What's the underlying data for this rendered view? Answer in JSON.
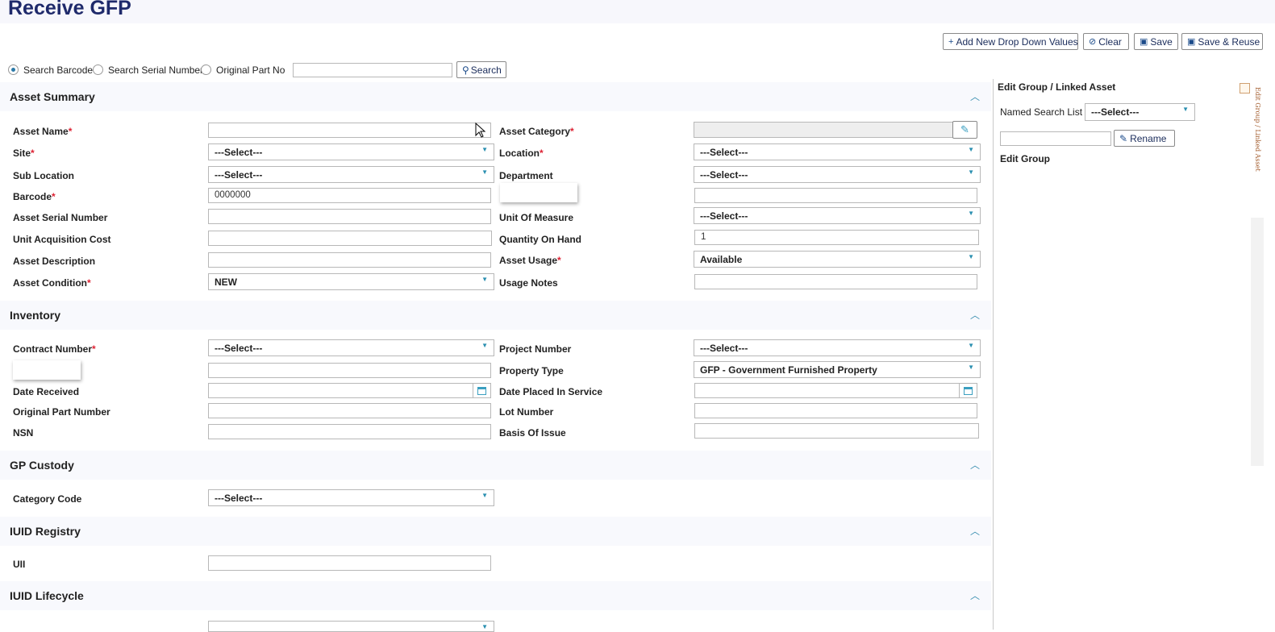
{
  "page": {
    "title": "Receive GFP"
  },
  "toolbar": {
    "add_label": "Add New Drop Down Values",
    "clear_label": "Clear",
    "save_label": "Save",
    "save_reuse_label": "Save & Reuse"
  },
  "search": {
    "options": [
      "Search Barcode",
      "Search Serial Number",
      "Original Part No"
    ],
    "selected": "Search Barcode",
    "input_value": "",
    "button_label": "Search"
  },
  "sections": {
    "asset_summary": "Asset Summary",
    "inventory": "Inventory",
    "gp_custody": "GP Custody",
    "iuid_registry": "IUID Registry",
    "iuid_lifecycle": "IUID Lifecycle"
  },
  "asset_summary": {
    "asset_name": {
      "label": "Asset Name",
      "value": ""
    },
    "asset_category": {
      "label": "Asset Category",
      "value": ""
    },
    "site": {
      "label": "Site",
      "value": "---Select---"
    },
    "location": {
      "label": "Location",
      "value": "---Select---"
    },
    "sub_location": {
      "label": "Sub Location",
      "value": "---Select---"
    },
    "department": {
      "label": "Department",
      "value": "---Select---"
    },
    "barcode": {
      "label": "Barcode",
      "value": "0000000"
    },
    "unlabeled_right": {
      "value": ""
    },
    "asset_serial_number": {
      "label": "Asset Serial Number",
      "value": ""
    },
    "unit_of_measure": {
      "label": "Unit Of Measure",
      "value": "---Select---"
    },
    "unit_acquisition_cost": {
      "label": "Unit Acquisition Cost",
      "value": ""
    },
    "quantity_on_hand": {
      "label": "Quantity On Hand",
      "value": "1"
    },
    "asset_description": {
      "label": "Asset Description",
      "value": ""
    },
    "asset_usage": {
      "label": "Asset Usage",
      "value": "Available"
    },
    "asset_condition": {
      "label": "Asset Condition",
      "value": "NEW"
    },
    "usage_notes": {
      "label": "Usage Notes",
      "value": ""
    }
  },
  "inventory": {
    "contract_number": {
      "label": "Contract Number",
      "value": "---Select---"
    },
    "project_number": {
      "label": "Project Number",
      "value": "---Select---"
    },
    "unlabeled_left": {
      "value": ""
    },
    "property_type": {
      "label": "Property Type",
      "value": "GFP - Government Furnished Property"
    },
    "date_received": {
      "label": "Date Received",
      "value": ""
    },
    "date_placed_in_service": {
      "label": "Date Placed In Service",
      "value": ""
    },
    "original_part_number": {
      "label": "Original Part Number",
      "value": ""
    },
    "lot_number": {
      "label": "Lot Number",
      "value": ""
    },
    "nsn": {
      "label": "NSN",
      "value": ""
    },
    "basis_of_issue": {
      "label": "Basis Of Issue",
      "value": ""
    }
  },
  "gp_custody": {
    "category_code": {
      "label": "Category Code",
      "value": "---Select---"
    }
  },
  "iuid_registry": {
    "uii": {
      "label": "UII",
      "value": ""
    }
  },
  "right_panel": {
    "title": "Edit Group / Linked Asset",
    "named_search_label": "Named Search List :",
    "named_search_value": "---Select---",
    "rename_input": "",
    "rename_label": "Rename",
    "edit_group_label": "Edit Group",
    "vertical_tab": "Edit Group / Linked Asset"
  },
  "colors": {
    "title": "#1f2a6b",
    "accent": "#2a8fb0",
    "required": "#dd2233"
  }
}
